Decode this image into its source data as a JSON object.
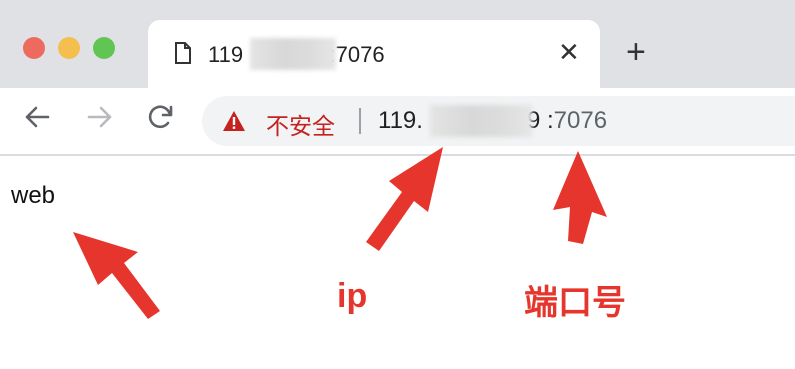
{
  "tab": {
    "title_prefix": "119",
    "title_suffix": "79:7076",
    "close_glyph": "✕",
    "new_tab_glyph": "+"
  },
  "omnibox": {
    "security_label": "不安全",
    "host_prefix": "119.",
    "host_suffix": "9",
    "port_separator": ":",
    "port": "7076"
  },
  "content": {
    "text": "web"
  },
  "annotations": {
    "ip_label": "ip",
    "port_label": "端口号",
    "color": "#e5352c"
  },
  "icons": {
    "traffic_lights": [
      "close",
      "minimize",
      "zoom"
    ],
    "nav": [
      "back-arrow-icon",
      "forward-arrow-icon",
      "reload-icon"
    ],
    "security": "warning-triangle-icon",
    "tab_favicon": "page-icon"
  }
}
